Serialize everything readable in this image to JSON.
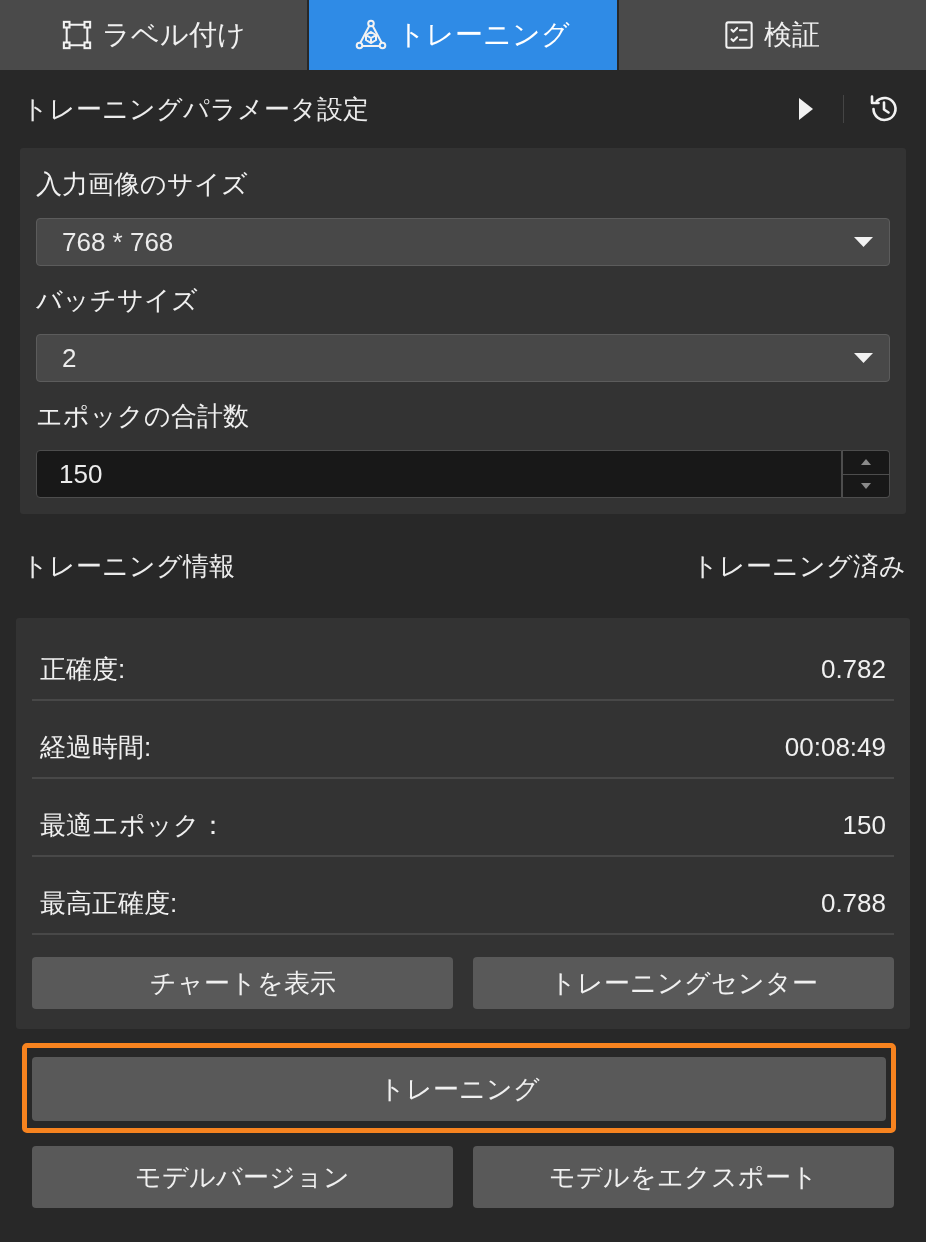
{
  "tabs": [
    {
      "label": "ラベル付け",
      "selected": false
    },
    {
      "label": "トレーニング",
      "selected": true
    },
    {
      "label": "検証",
      "selected": false
    }
  ],
  "parameters": {
    "title": "トレーニングパラメータ設定",
    "fields": [
      {
        "kind": "select",
        "label": "入力画像のサイズ",
        "value": "768 * 768"
      },
      {
        "kind": "select",
        "label": "バッチサイズ",
        "value": "2"
      },
      {
        "kind": "number",
        "label": "エポックの合計数",
        "value": "150"
      }
    ]
  },
  "info": {
    "title": "トレーニング情報",
    "status": "トレーニング済み",
    "rows": [
      {
        "label": "正確度:",
        "value": "0.782"
      },
      {
        "label": "経過時間:",
        "value": "00:08:49"
      },
      {
        "label": "最適エポック：",
        "value": "150"
      },
      {
        "label": "最高正確度:",
        "value": "0.788"
      }
    ],
    "buttons": [
      "チャートを表示",
      "トレーニングセンター"
    ]
  },
  "actions": {
    "train_button": {
      "label": "トレーニング",
      "highlighted": true
    },
    "buttons": [
      "モデルバージョン",
      "モデルをエクスポート"
    ]
  }
}
